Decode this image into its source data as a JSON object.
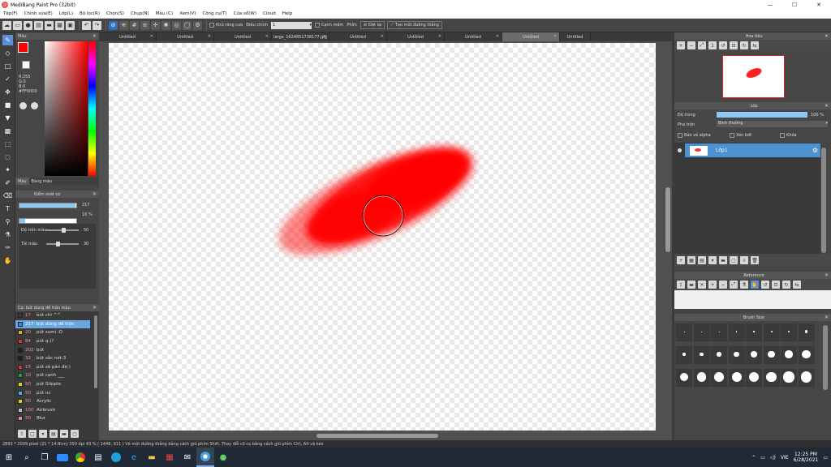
{
  "window": {
    "title": "MediBang Paint Pro (32bit)",
    "minimize": "—",
    "maximize": "☐",
    "close": "✕"
  },
  "menu": [
    "Tệp(F)",
    "Chỉnh sửa(E)",
    "Lớp(L)",
    "Bộ lọc(R)",
    "Chọn(S)",
    "Chụp(N)",
    "Màu (C)",
    "Xem(V)",
    "Công cụ(T)",
    "Cửa sổ(W)",
    "Cloud",
    "Help"
  ],
  "toolbar": {
    "antialias_label": "Khử răng cưa",
    "correction_label": "Điều chỉnh",
    "correction_value": "1",
    "edge_label": "Cạnh mềm",
    "key_label": "Phím",
    "straight_label": "Đặt lại",
    "create_line_label": "Tạo một đường thẳng"
  },
  "color_panel": {
    "title": "Màu",
    "r": "R:255",
    "g": "G:0",
    "b": "B:0",
    "hex": "#FF0000",
    "tabs": [
      "Màu",
      "Bảng màu"
    ]
  },
  "brush_control": {
    "title": "Kiểm soát cọ",
    "size_value": "217",
    "size_fraction": 0.99,
    "opacity_value": "10 %",
    "opacity_fraction": 0.1,
    "mix_label": "Độ trộn màu",
    "mix_value": "50",
    "mix_fraction": 0.55,
    "water_label": "Tải màu",
    "water_value": "30",
    "water_fraction": 0.35
  },
  "brush_list": {
    "title": "Cọ: bút dùng để trộn màu",
    "items": [
      {
        "num": "17",
        "name": "bút chì ^^",
        "color": "#3a3a3a"
      },
      {
        "num": "217",
        "name": "bút dùng để trộn",
        "color": "#2b8fe0",
        "selected": true
      },
      {
        "num": "20",
        "name": "pút sumi :D",
        "color": "#e0b020"
      },
      {
        "num": "84",
        "name": "pút q:)?",
        "color": "#e03030"
      },
      {
        "num": "202",
        "name": "bút",
        "color": "#202020"
      },
      {
        "num": "32",
        "name": "bút sắc nét:3",
        "color": "#202020"
      },
      {
        "num": "15",
        "name": "pút zê pán đè:)",
        "color": "#e03030"
      },
      {
        "num": "10",
        "name": "pút cạnh ___",
        "color": "#30a030"
      },
      {
        "num": "50",
        "name": "pút Stipple",
        "color": "#e0d020"
      },
      {
        "num": "50",
        "name": "pút nc",
        "color": "#40b0e0"
      },
      {
        "num": "50",
        "name": "Acrylic",
        "color": "#e0d020"
      },
      {
        "num": "100",
        "name": "Airbrush",
        "color": "#bbbbbb"
      },
      {
        "num": "50",
        "name": "Blur",
        "color": "#e080c0"
      }
    ]
  },
  "doc_tabs": [
    "Untitled",
    "Untitled",
    "Untitled",
    "large_1624851738177.jpg",
    "Untitled",
    "Untitled",
    "Untitled",
    "Untitled",
    "Untitled"
  ],
  "navigator": {
    "title": "Hoa tiêu"
  },
  "layer_panel": {
    "title": "Lớp",
    "opacity_label": "Độ trong",
    "opacity_value": "100 %",
    "opacity_fraction": 1.0,
    "blend_label": "Pha trộn",
    "blend_value": "Bình thường",
    "protect_alpha": "Bảo vệ alpha",
    "clipping": "Xén bớt",
    "lock": "Khóa",
    "layer_name": "Lớp1"
  },
  "reference": {
    "title": "Reference"
  },
  "brush_size": {
    "title": "Brush Size",
    "sizes": [
      "",
      "",
      "",
      "",
      "",
      "",
      "",
      "",
      "",
      "",
      "",
      "",
      "",
      "",
      "",
      "",
      "",
      "",
      "",
      "",
      "",
      "",
      "",
      ""
    ]
  },
  "status": {
    "text": "2893 * 2039 pixel  (21 * 14.8cm)  350 dpi  43 %  ( 1448, 911 )  Vẽ một đường thẳng bằng cách giữ phím Shift, Thay đổi cỡ cọ bằng cách giữ phím Ctrl, Alt và kéo"
  },
  "taskbar": {
    "lang": "VIE",
    "time": "12:25 PM",
    "date": "6/28/2021"
  }
}
